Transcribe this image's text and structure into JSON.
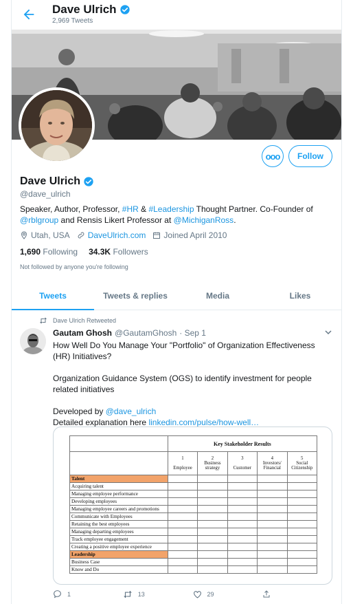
{
  "header": {
    "name": "Dave Ulrich",
    "tweet_count": "2,969 Tweets"
  },
  "profile": {
    "name": "Dave Ulrich",
    "handle": "@dave_ulrich",
    "more_label": "ooo",
    "follow_label": "Follow",
    "bio": {
      "t1": "Speaker, Author, Professor, ",
      "tag_hr": "#HR",
      "t2": " & ",
      "tag_leadership": "#Leadership",
      "t3": " Thought Partner. Co-Founder of ",
      "mention_rbl": "@rblgroup",
      "t4": " and Rensis Likert Professor at ",
      "mention_ross": "@MichiganRoss",
      "t5": "."
    },
    "location": "Utah, USA",
    "website": "DaveUlrich.com",
    "joined": "Joined April 2010",
    "following_count": "1,690",
    "following_label": "Following",
    "followers_count": "34.3K",
    "followers_label": "Followers",
    "not_followed": "Not followed by anyone you're following"
  },
  "tabs": [
    "Tweets",
    "Tweets & replies",
    "Media",
    "Likes"
  ],
  "tweet": {
    "retweet_note": "Dave Ulrich Retweeted",
    "author_name": "Gautam Ghosh",
    "author_handle": "@GautamGhosh",
    "date": "· Sep 1",
    "para1": "How Well Do You Manage Your \"Portfolio\" of Organization Effectiveness (HR) Initiatives?",
    "para2": "Organization Guidance System (OGS) to identify investment for people related initiatives",
    "dev_prefix": "Developed by ",
    "dev_mention": "@dave_ulrich",
    "expl_prefix": "Detailed explanation here  ",
    "expl_link": "linkedin.com/pulse/how-well…",
    "reply_count": "1",
    "retweet_count": "13",
    "like_count": "29"
  },
  "document": {
    "title": "Key Stakeholder Results",
    "columns": [
      {
        "num": "1",
        "label": "Employee"
      },
      {
        "num": "2",
        "label": "Business strategy"
      },
      {
        "num": "3",
        "label": "Customer"
      },
      {
        "num": "4",
        "label": "Investors/ Financial"
      },
      {
        "num": "5",
        "label": "Social Citizenship"
      }
    ],
    "rows": [
      {
        "label": "Talent",
        "section": true
      },
      {
        "label": "Acquiring talent"
      },
      {
        "label": "Managing employee performance"
      },
      {
        "label": "Developing employees"
      },
      {
        "label": "Managing employee careers and promotions"
      },
      {
        "label": "Communicate with Employees"
      },
      {
        "label": "Retaining the best employees"
      },
      {
        "label": "Managing departing employees"
      },
      {
        "label": "Track employee engagement"
      },
      {
        "label": "Creating a positive employee experience"
      },
      {
        "label": "Leadership",
        "section": true
      },
      {
        "label": "Business Case"
      },
      {
        "label": "Know and Do"
      }
    ]
  },
  "colors": {
    "accent": "#1da1f2",
    "link": "#1b95e0",
    "muted": "#657786",
    "section_fill": "#f2a36a"
  }
}
